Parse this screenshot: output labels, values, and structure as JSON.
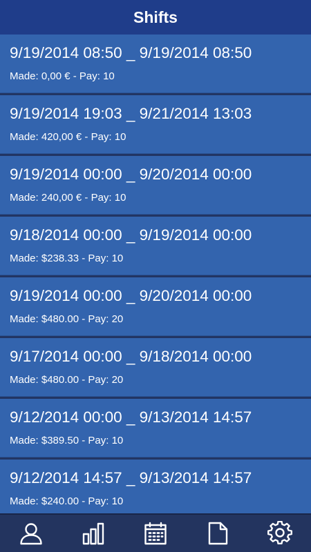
{
  "header": {
    "title": "Shifts"
  },
  "shifts": [
    {
      "range": "9/19/2014 08:50 _ 9/19/2014 08:50",
      "detail": "Made: 0,00 € - Pay: 10"
    },
    {
      "range": "9/19/2014 19:03 _ 9/21/2014 13:03",
      "detail": "Made: 420,00 € - Pay: 10"
    },
    {
      "range": "9/19/2014 00:00 _ 9/20/2014 00:00",
      "detail": "Made: 240,00 € - Pay: 10"
    },
    {
      "range": "9/18/2014 00:00 _ 9/19/2014 00:00",
      "detail": "Made: $238.33 - Pay: 10"
    },
    {
      "range": "9/19/2014 00:00 _ 9/20/2014 00:00",
      "detail": "Made: $480.00 - Pay: 20"
    },
    {
      "range": "9/17/2014 00:00 _ 9/18/2014 00:00",
      "detail": "Made: $480.00 - Pay: 20"
    },
    {
      "range": "9/12/2014 00:00 _ 9/13/2014 14:57",
      "detail": "Made: $389.50 - Pay: 10"
    },
    {
      "range": "9/12/2014 14:57 _ 9/13/2014 14:57",
      "detail": "Made: $240.00 - Pay: 10"
    }
  ],
  "tabbar": {
    "items": [
      {
        "icon": "person-icon"
      },
      {
        "icon": "bar-chart-icon"
      },
      {
        "icon": "calendar-icon"
      },
      {
        "icon": "document-icon"
      },
      {
        "icon": "gear-icon"
      }
    ]
  },
  "colors": {
    "header": "#1f3d8a",
    "row": "#3364ae",
    "tabbar": "#23345f",
    "text": "#ffffff"
  }
}
